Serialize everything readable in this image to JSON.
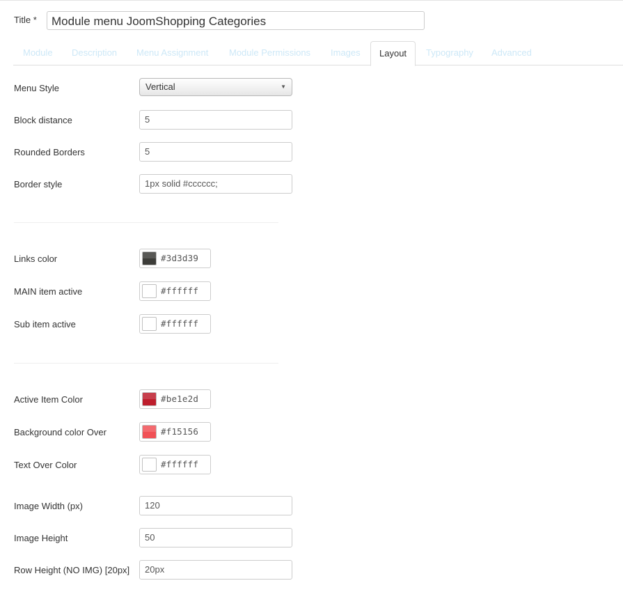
{
  "title": {
    "label": "Title *",
    "value": "Module menu JoomShopping Categories"
  },
  "tabs": [
    {
      "label": "Module"
    },
    {
      "label": "Description"
    },
    {
      "label": "Menu Assignment"
    },
    {
      "label": "Module Permissions"
    },
    {
      "label": "Images"
    },
    {
      "label": "Layout",
      "active": true
    },
    {
      "label": "Typography"
    },
    {
      "label": "Advanced"
    }
  ],
  "layout": {
    "menu_style": {
      "label": "Menu Style",
      "value": "Vertical"
    },
    "block_distance": {
      "label": "Block distance",
      "value": "5"
    },
    "rounded_borders": {
      "label": "Rounded Borders",
      "value": "5"
    },
    "border_style": {
      "label": "Border style",
      "value": "1px solid #cccccc;"
    },
    "links_color": {
      "label": "Links color",
      "value": "#3d3d39",
      "swatch": "#3d3d39"
    },
    "main_item_active": {
      "label": "MAIN item active",
      "value": "#ffffff",
      "swatch": "#ffffff"
    },
    "sub_item_active": {
      "label": "Sub item active",
      "value": "#ffffff",
      "swatch": "#ffffff"
    },
    "active_item_color": {
      "label": "Active Item Color",
      "value": "#be1e2d",
      "swatch": "#be1e2d"
    },
    "background_color_over": {
      "label": "Background color Over",
      "value": "#f15156",
      "swatch": "#f15156"
    },
    "text_over_color": {
      "label": "Text Over Color",
      "value": "#ffffff",
      "swatch": "#ffffff"
    },
    "image_width": {
      "label": "Image Width (px)",
      "value": "120"
    },
    "image_height": {
      "label": "Image Height",
      "value": "50"
    },
    "row_height": {
      "label": "Row Height (NO IMG) [20px]",
      "value": "20px"
    }
  },
  "icons": {
    "select_arrow": "caret-down-icon"
  }
}
